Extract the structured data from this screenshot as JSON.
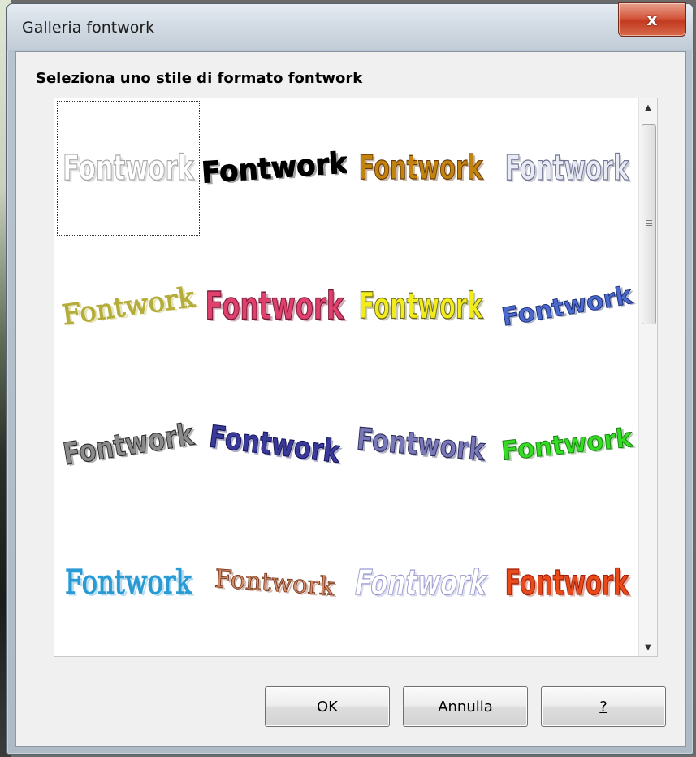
{
  "window": {
    "title": "Galleria fontwork",
    "close_glyph": "x",
    "heading": "Seleziona uno stile di formato fontwork"
  },
  "gallery": {
    "items": [
      {
        "label": "Fontwork",
        "style": "outline-gray",
        "fill": "#ffffff",
        "stroke": "#a8a8a8"
      },
      {
        "label": "Fontwork",
        "style": "arch-black",
        "fill": "#000000",
        "stroke": "#000000"
      },
      {
        "label": "Fontwork",
        "style": "gold-gradient",
        "fill": "#c2840c",
        "stroke": "#6b3a08"
      },
      {
        "label": "Fontwork",
        "style": "silver-3d",
        "fill": "#e8eaf4",
        "stroke": "#6e7290"
      },
      {
        "label": "Fontwork",
        "style": "olive-serif-slant",
        "fill": "#b5ad3a",
        "stroke": "#b5ad3a"
      },
      {
        "label": "Fontwork",
        "style": "pink-perspective",
        "fill": "#e0406c",
        "stroke": "#7a1a3a"
      },
      {
        "label": "Fontwork",
        "style": "yellow-3d",
        "fill": "#f2ec1a",
        "stroke": "#6b6a20"
      },
      {
        "label": "Fontwork",
        "style": "blue-rising",
        "fill": "#4a6ad0",
        "stroke": "#1a2a6a"
      },
      {
        "label": "Fontwork",
        "style": "gray-3d-wave",
        "fill": "#8a8a8a",
        "stroke": "#2a2a2a"
      },
      {
        "label": "Fontwork",
        "style": "navy-wave",
        "fill": "#3a3a9a",
        "stroke": "#14145a"
      },
      {
        "label": "Fontwork",
        "style": "lavender-wave",
        "fill": "#7878b8",
        "stroke": "#2a2a5a"
      },
      {
        "label": "Fontwork",
        "style": "green-arc",
        "fill": "#33dd22",
        "stroke": "#1a7a12"
      },
      {
        "label": "Fontwork",
        "style": "cyan-serif",
        "fill": "#2a9ad4",
        "stroke": "#2a9ad4"
      },
      {
        "label": "Fontwork",
        "style": "copper-arch",
        "fill": "#d8906a",
        "stroke": "#7a3a20"
      },
      {
        "label": "Fontwork",
        "style": "lilac-outline-slant",
        "fill": "#ffffff",
        "stroke": "#9a9ad0"
      },
      {
        "label": "Fontwork",
        "style": "fire-gradient",
        "fill": "#e84a1a",
        "stroke": "#a0200a"
      }
    ]
  },
  "buttons": {
    "ok": "OK",
    "cancel": "Annulla",
    "help": "?"
  }
}
